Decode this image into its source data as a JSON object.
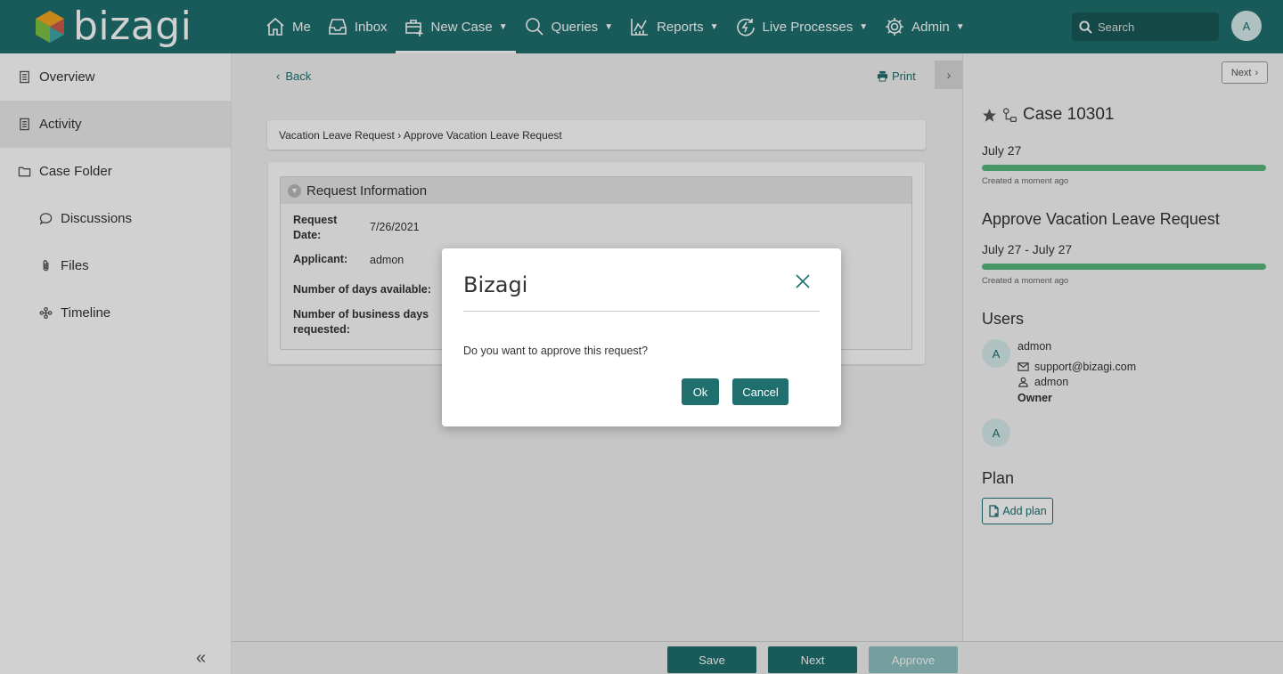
{
  "brand": {
    "name": "bizagi"
  },
  "nav": [
    {
      "label": "Me",
      "icon": "home-icon",
      "has_caret": false
    },
    {
      "label": "Inbox",
      "icon": "inbox-icon",
      "has_caret": false
    },
    {
      "label": "New Case",
      "icon": "new-case-icon",
      "has_caret": true
    },
    {
      "label": "Queries",
      "icon": "search-icon",
      "has_caret": true
    },
    {
      "label": "Reports",
      "icon": "chart-icon",
      "has_caret": true
    },
    {
      "label": "Live Processes",
      "icon": "live-process-icon",
      "has_caret": true
    },
    {
      "label": "Admin",
      "icon": "gear-icon",
      "has_caret": true
    }
  ],
  "search": {
    "placeholder": "Search"
  },
  "user": {
    "initial": "A"
  },
  "sidebar": {
    "items": [
      {
        "label": "Overview",
        "icon": "document-icon"
      },
      {
        "label": "Activity",
        "icon": "document-icon"
      },
      {
        "label": "Case Folder",
        "icon": "folder-icon"
      },
      {
        "label": "Discussions",
        "icon": "chat-icon"
      },
      {
        "label": "Files",
        "icon": "paperclip-icon"
      },
      {
        "label": "Timeline",
        "icon": "timeline-icon"
      }
    ]
  },
  "toolbar": {
    "back_label": "Back",
    "print_label": "Print"
  },
  "breadcrumb": "Vacation Leave Request › Approve Vacation Leave Request",
  "form": {
    "group_title": "Request Information",
    "fields": [
      {
        "label": "Request Date:",
        "value": "7/26/2021"
      },
      {
        "label": "Applicant:",
        "value": "admon"
      },
      {
        "label": "Number of days available:",
        "value": ""
      },
      {
        "label": "Number of business days requested:",
        "value": ""
      }
    ]
  },
  "right_panel": {
    "next_label": "Next",
    "case_title": "Case 10301",
    "case_date": "July 27",
    "case_created": "Created a moment ago",
    "activity_title": "Approve Vacation Leave Request",
    "activity_dates": "July 27 - July 27",
    "activity_created": "Created a moment ago",
    "users_heading": "Users",
    "users": [
      {
        "initial": "A",
        "name": "admon",
        "email": "support@bizagi.com",
        "username": "admon",
        "role": "Owner"
      },
      {
        "initial": "A"
      }
    ],
    "plan_heading": "Plan",
    "add_plan_label": "Add plan",
    "progress_color": "#57b77e"
  },
  "bottom": {
    "save_label": "Save",
    "next_label": "Next",
    "approve_label": "Approve"
  },
  "modal": {
    "title": "Bizagi",
    "message": "Do you want to approve this request?",
    "ok_label": "Ok",
    "cancel_label": "Cancel"
  },
  "colors": {
    "brand": "#1e6f6e",
    "success": "#57b77e"
  }
}
